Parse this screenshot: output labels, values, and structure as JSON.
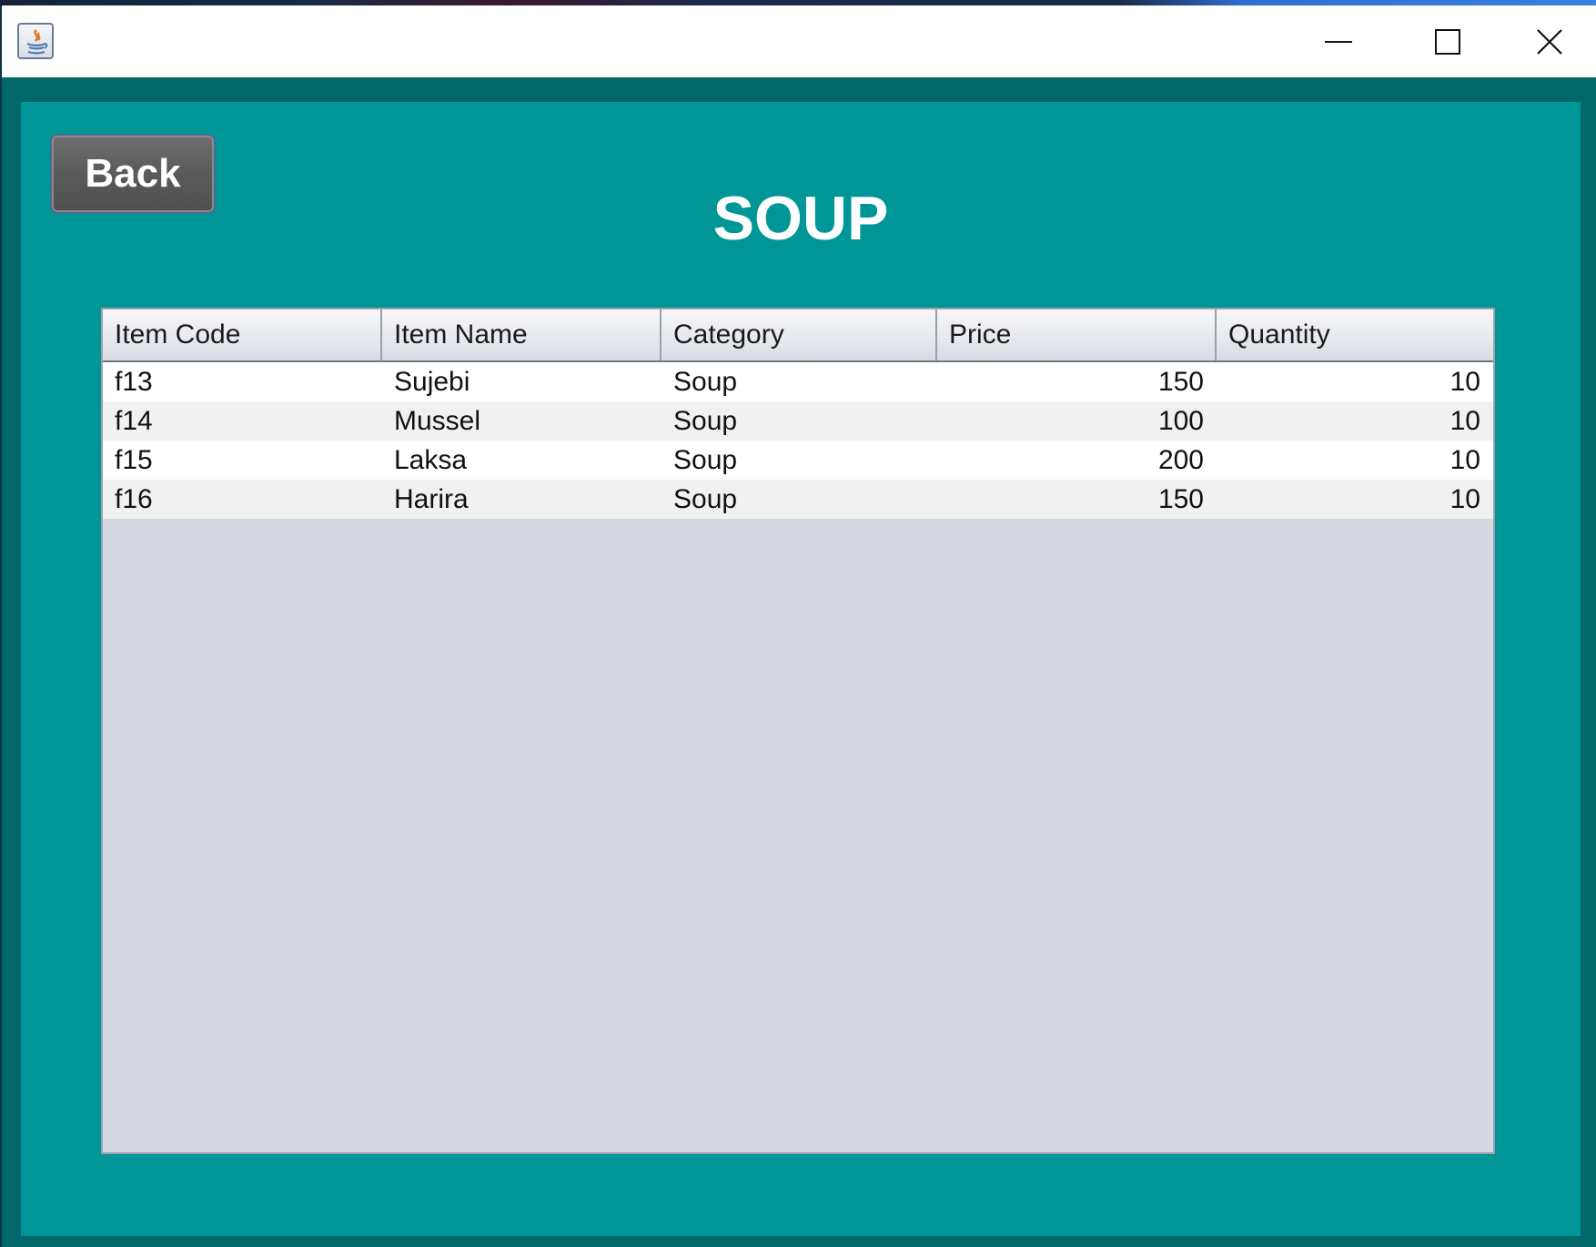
{
  "window": {
    "icon": "java-app-icon",
    "controls": {
      "minimize": "minimize-icon",
      "maximize": "maximize-icon",
      "close": "close-icon"
    }
  },
  "header": {
    "back_label": "Back",
    "title": "SOUP"
  },
  "table": {
    "columns": [
      "Item Code",
      "Item Name",
      "Category",
      "Price",
      "Quantity"
    ],
    "rows": [
      {
        "code": "f13",
        "name": "Sujebi",
        "category": "Soup",
        "price": "150",
        "quantity": "10"
      },
      {
        "code": "f14",
        "name": "Mussel",
        "category": "Soup",
        "price": "100",
        "quantity": "10"
      },
      {
        "code": "f15",
        "name": "Laksa",
        "category": "Soup",
        "price": "200",
        "quantity": "10"
      },
      {
        "code": "f16",
        "name": "Harira",
        "category": "Soup",
        "price": "150",
        "quantity": "10"
      }
    ]
  },
  "colors": {
    "background": "#009697",
    "frame": "#006868",
    "table_empty": "#d6d9e1",
    "button": "#5a5a5a"
  }
}
